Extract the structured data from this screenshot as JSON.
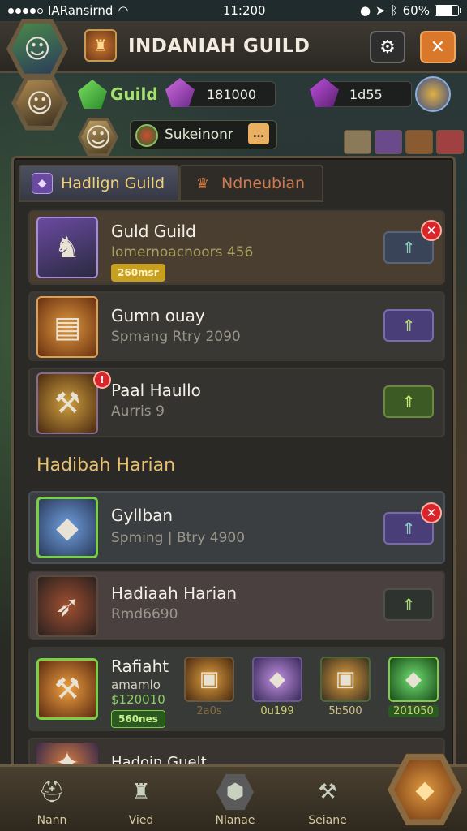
{
  "status_bar": {
    "carrier": "IARansirnd",
    "time": "11:200",
    "battery": "60%"
  },
  "header": {
    "title": "INDANIAH GUILD",
    "settings_icon": "gear-icon",
    "close_icon": "close-icon"
  },
  "resources": {
    "guild_label": "Guild",
    "resource_1": "181000",
    "resource_2": "1d55"
  },
  "sub_header": {
    "chip_label": "Sukeinonr"
  },
  "tabs": [
    {
      "label": "Hadlign Guild",
      "active": true
    },
    {
      "label": "Ndneubian",
      "active": false
    }
  ],
  "rows_top": [
    {
      "name": "Guld Guild",
      "sub": "Iomernoacnoors  456",
      "pill": "260msr",
      "action": "blue",
      "badge": true
    },
    {
      "name": "Gumn ouay",
      "sub": "Spmang     Rtry 2090",
      "pill": "",
      "action": "purple",
      "badge": false
    },
    {
      "name": "Paal Haullo",
      "sub": "Aurris 9",
      "pill": "",
      "action": "green",
      "badge": false
    }
  ],
  "section": {
    "title": "Hadibah Harian"
  },
  "rows_bottom": [
    {
      "name": "Gyllban",
      "sub": "Spming  |  Btry 4900",
      "action": "purple",
      "badge": true
    },
    {
      "name": "Hadiaah Harian",
      "sub": "Rmd6690",
      "action": "dark",
      "badge": false
    }
  ],
  "reward_row": {
    "name": "Rafiaht",
    "sub": "amamlo",
    "price": "$120010",
    "pill": "560nes",
    "items": [
      {
        "label": "2a0s",
        "color": "#8a6a40"
      },
      {
        "label": "0u199",
        "color": "#d0d070"
      },
      {
        "label": "5b500",
        "color": "#d0c080"
      },
      {
        "label": "201050",
        "color": "#d0d070"
      }
    ]
  },
  "partial_row": {
    "name": "Hadoin Guelt"
  },
  "nav": [
    {
      "label": "Nann",
      "icon": "helmet-icon"
    },
    {
      "label": "Vied",
      "icon": "tower-icon"
    },
    {
      "label": "Nlanae",
      "icon": "shield-icon"
    },
    {
      "label": "Seiane",
      "icon": "hammer-icon"
    }
  ],
  "colors": {
    "accent_gold": "#e8c070",
    "panel_bg": "#2b2926",
    "border": "#5e523f"
  }
}
